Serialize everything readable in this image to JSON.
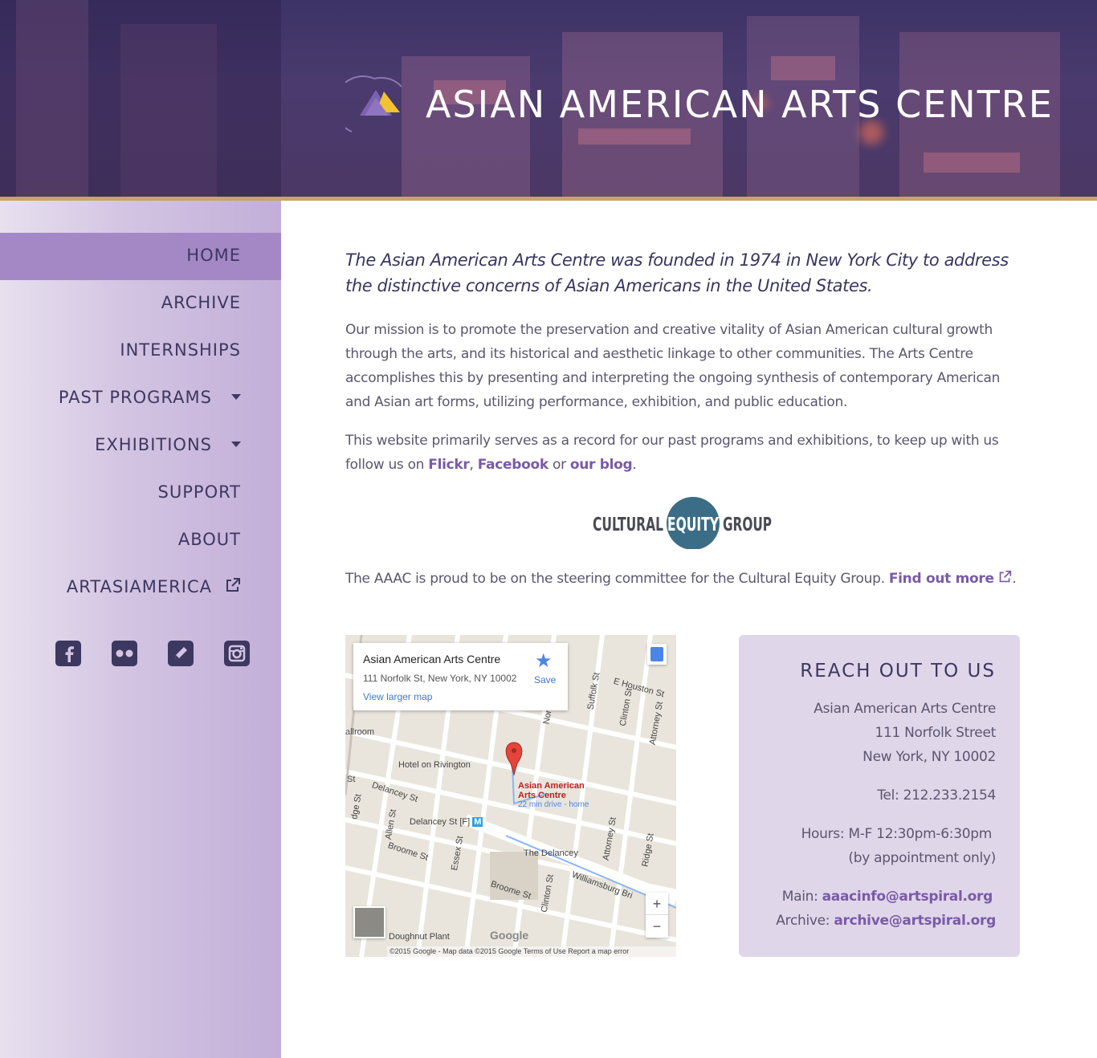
{
  "header": {
    "site_title": "ASIAN AMERICAN ARTS CENTRE",
    "logo_icon": "triangle-logo-icon"
  },
  "nav": {
    "items": [
      {
        "label": "HOME",
        "active": true
      },
      {
        "label": "ARCHIVE"
      },
      {
        "label": "INTERNSHIPS"
      },
      {
        "label": "PAST PROGRAMS",
        "has_dropdown": true
      },
      {
        "label": "EXHIBITIONS",
        "has_dropdown": true
      },
      {
        "label": "SUPPORT"
      },
      {
        "label": "ABOUT"
      },
      {
        "label": "ARTASIAMERICA",
        "external": true
      }
    ],
    "social": [
      "facebook-icon",
      "flickr-icon",
      "blog-pencil-icon",
      "instagram-icon"
    ]
  },
  "main": {
    "lead": "The Asian American Arts Centre was founded in 1974 in New York City to address the distinctive concerns of Asian Americans in the United States.",
    "mission": "Our mission is to promote the preservation and creative vitality of Asian American cultural growth through the arts, and its historical and aesthetic linkage to other communities. The Arts Centre accomplishes this by presenting and interpreting the ongoing synthesis of contemporary American and Asian art forms, utilizing performance, exhibition, and public education.",
    "follow_prefix": "This website primarily serves as a record for our past programs and exhibitions, to keep up with us follow us on ",
    "follow_link_flickr": "Flickr",
    "follow_sep1": ", ",
    "follow_link_facebook": "Facebook",
    "follow_sep2": " or ",
    "follow_link_blog": "our blog",
    "follow_end": ".",
    "ceg_logo": {
      "left": "CULTURAL",
      "middle": "EQUITY",
      "right": "GROUP"
    },
    "ceg_text": "The AAAC is proud to be on the steering committee for the Cultural Equity Group. ",
    "ceg_link": "Find out more",
    "ceg_end": "."
  },
  "map": {
    "place_title": "Asian American Arts Centre",
    "place_address": "111 Norfolk St, New York, NY 10002",
    "larger_map": "View larger map",
    "save": "Save",
    "pin_label_1": "Asian American",
    "pin_label_2": "Arts Centre",
    "drive": "22 min drive - home",
    "zoom_in": "+",
    "zoom_out": "−",
    "google": "Google",
    "footer": "©2015 Google - Map data ©2015 Google    Terms of Use    Report a map error",
    "labels": {
      "e_houston": "E Houston St",
      "delancey": "Delancey St",
      "delancey_station": "Delancey St [F]",
      "hotel": "Hotel on Rivington",
      "the_delancey": "The Delancey",
      "broome": "Broome St",
      "broome2": "Broome St",
      "williamsburg": "Williamsburg Bri",
      "doughnut": "Doughnut Plant",
      "norfolk": "Norfolk",
      "suffolk": "Suffolk St",
      "clinton": "Clinton St",
      "clinton2": "Clinton St",
      "attorney": "Attorney St",
      "attorney2": "Attorney St",
      "ridge": "Ridge St",
      "essex": "Essex St",
      "allen": "Allen St",
      "ludlow": "dge St",
      "ballroom": "allroom",
      "st": "St"
    }
  },
  "contact": {
    "heading": "REACH OUT TO US",
    "name": "Asian American Arts Centre",
    "street": "111 Norfolk Street",
    "city": "New York, NY 10002",
    "tel": "Tel: 212.233.2154",
    "hours": "Hours: M-F 12:30pm-6:30pm",
    "hours_note": "(by appointment only)",
    "main_label": "Main: ",
    "main_email": "aaacinfo@artspiral.org",
    "archive_label": "Archive: ",
    "archive_email": "archive@artspiral.org"
  }
}
